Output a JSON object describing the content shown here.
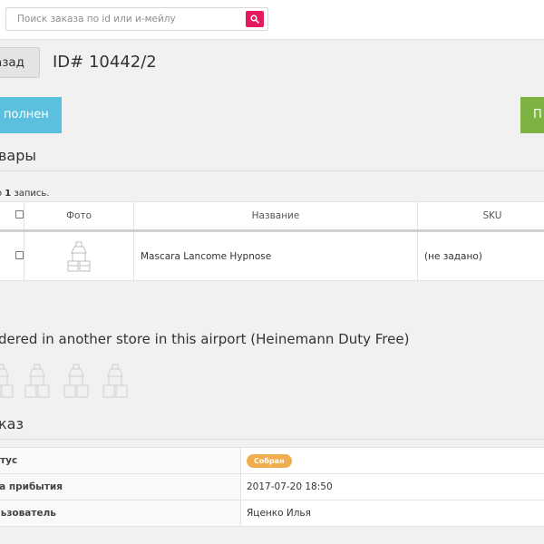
{
  "search": {
    "placeholder": "Поиск заказа по id или и-мейлу",
    "value": ""
  },
  "header": {
    "back_label": "азад",
    "order_id": "ID# 10442/2"
  },
  "actions": {
    "status_button": "полнен",
    "right_button": "П"
  },
  "goods": {
    "title": "вары",
    "summary_prefix": "о ",
    "summary_count": "1",
    "summary_suffix": " запись.",
    "columns": [
      "",
      "Фото",
      "Название",
      "SKU"
    ],
    "rows": [
      {
        "name": "Mascara Lancome Hypnose",
        "sku": "(не задано)"
      }
    ]
  },
  "other_store": {
    "title": "dered in another store in this airport (Heinemann Duty Free)"
  },
  "order": {
    "title": "каз",
    "rows": [
      {
        "key": "атус",
        "value": "Собран",
        "type": "badge"
      },
      {
        "key": "та прибытия",
        "value": "2017-07-20 18:50"
      },
      {
        "key": "льзователь",
        "value": "Яценко Илья"
      }
    ]
  },
  "colors": {
    "search_button": "#e5195d",
    "status_button": "#5bc0de",
    "right_button": "#7cb342",
    "badge": "#f0ad4e"
  },
  "icons": [
    "search-icon",
    "product-placeholder-icon"
  ]
}
